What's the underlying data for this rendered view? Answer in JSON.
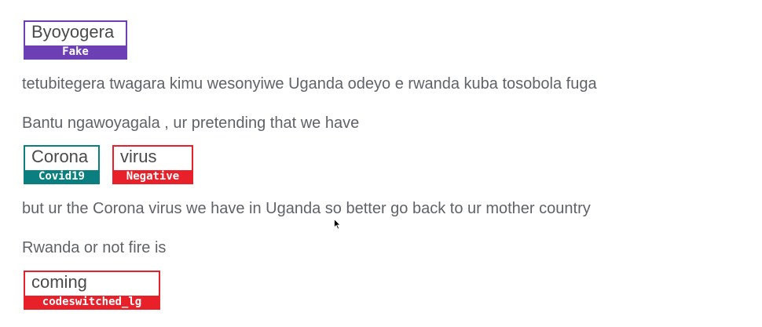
{
  "colors": {
    "text": "#5f6368",
    "tag_fake": "#6c3fb5",
    "tag_covid19": "#0b7f7f",
    "tag_negative": "#e8202a",
    "tag_codeswitched": "#e8202a"
  },
  "annotations": [
    {
      "word": "Byoyogera",
      "label": "Fake",
      "color": "#6c3fb5"
    },
    {
      "word": "Corona",
      "label": "Covid19",
      "color": "#0b7f7f"
    },
    {
      "word": "virus",
      "label": "Negative",
      "color": "#e8202a"
    },
    {
      "word": "coming",
      "label": "codeswitched_lg",
      "color": "#e8202a"
    }
  ],
  "lines": [
    "tetubitegera twagara kimu wesonyiwe Uganda odeyo e rwanda kuba tosobola fuga",
    "Bantu ngawoyagala , ur pretending that we have",
    "but ur the Corona virus we have in Uganda so better go back to ur mother  country",
    "Rwanda or not fire is"
  ],
  "cursor_icon": "mouse-pointer-icon"
}
